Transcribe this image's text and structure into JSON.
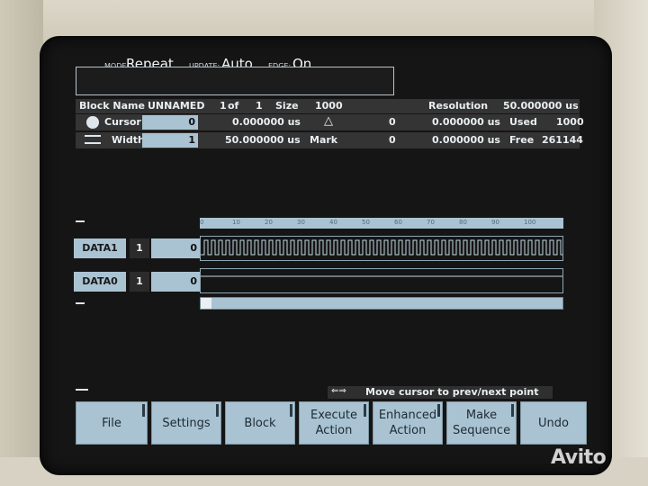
{
  "header": {
    "mode_label": "MODE:",
    "mode_value": "Repeat",
    "update_label": "UPDATE:",
    "update_value": "Auto",
    "edge_label": "EDGE:",
    "edge_value": "On"
  },
  "block": {
    "name_label": "Block Name",
    "name_value": "UNNAMED",
    "index_value": "1",
    "of_label": "of",
    "total_value": "1",
    "size_label": "Size",
    "size_value": "1000",
    "resolution_label": "Resolution",
    "resolution_value": "50.000000 us"
  },
  "cursor_row": {
    "label": "Cursor",
    "field_value": "0",
    "time_value": "0.000000 us",
    "delta_symbol": "△",
    "delta_count": "0",
    "delta_time": "0.000000 us",
    "used_label": "Used",
    "used_value": "1000"
  },
  "width_row": {
    "label": "Width",
    "field_value": "1",
    "time_value": "50.000000 us",
    "mark_label": "Mark",
    "mark_count": "0",
    "mark_time": "0.000000 us",
    "free_label": "Free",
    "free_value": "261144"
  },
  "ruler": {
    "ticks": [
      "0",
      "10",
      "20",
      "30",
      "40",
      "50",
      "60",
      "70",
      "80",
      "90",
      "100"
    ]
  },
  "channels": [
    {
      "name": "DATA1",
      "level": "1",
      "value": "0"
    },
    {
      "name": "DATA0",
      "level": "1",
      "value": "0"
    }
  ],
  "status": {
    "hint": "Move cursor to prev/next point"
  },
  "softkeys": [
    "File",
    "Settings",
    "Block",
    "Execute Action",
    "Enhanced Action",
    "Make Sequence",
    "Undo"
  ],
  "watermark": "Avito",
  "colors": {
    "screen_bg": "#151515",
    "field_bg": "#a9c3d2",
    "text": "#e9eef1"
  }
}
